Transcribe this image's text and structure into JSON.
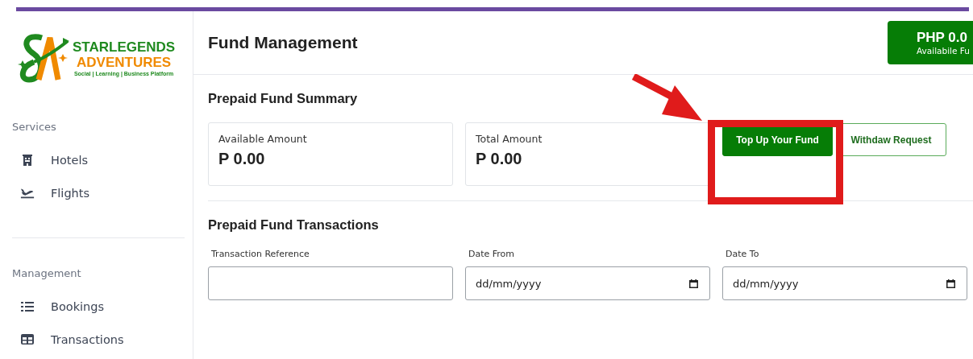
{
  "brand": {
    "line1": "STARLEGENDS",
    "line2": "ADVENTURES",
    "tagline": "Social | Learning | Business Platform"
  },
  "sidebar": {
    "sections": [
      {
        "title": "Services",
        "items": [
          {
            "label": "Hotels",
            "kind": "hotel"
          },
          {
            "label": "Flights",
            "kind": "flight"
          }
        ]
      },
      {
        "title": "Management",
        "items": [
          {
            "label": "Bookings",
            "kind": "list"
          },
          {
            "label": "Transactions",
            "kind": "table"
          }
        ]
      }
    ]
  },
  "header": {
    "title": "Fund Management",
    "balance": {
      "amount": "PHP 0.0",
      "caption": "Availabile Fu"
    }
  },
  "summary": {
    "title": "Prepaid Fund Summary",
    "cards": [
      {
        "label": "Available Amount",
        "value": "P 0.00"
      },
      {
        "label": "Total Amount",
        "value": "P 0.00"
      }
    ],
    "buttons": [
      {
        "label": "Top Up Your Fund",
        "kind": "primary"
      },
      {
        "label": "Withdaw Request",
        "kind": "outline"
      }
    ]
  },
  "transactions": {
    "title": "Prepaid Fund Transactions",
    "filters": [
      {
        "label": "Transaction Reference",
        "kind": "text"
      },
      {
        "label": "Date From",
        "kind": "date",
        "placeholder": "dd/mm/yyyy"
      },
      {
        "label": "Date To",
        "kind": "date",
        "placeholder": "dd/mm/yyyy"
      }
    ]
  }
}
